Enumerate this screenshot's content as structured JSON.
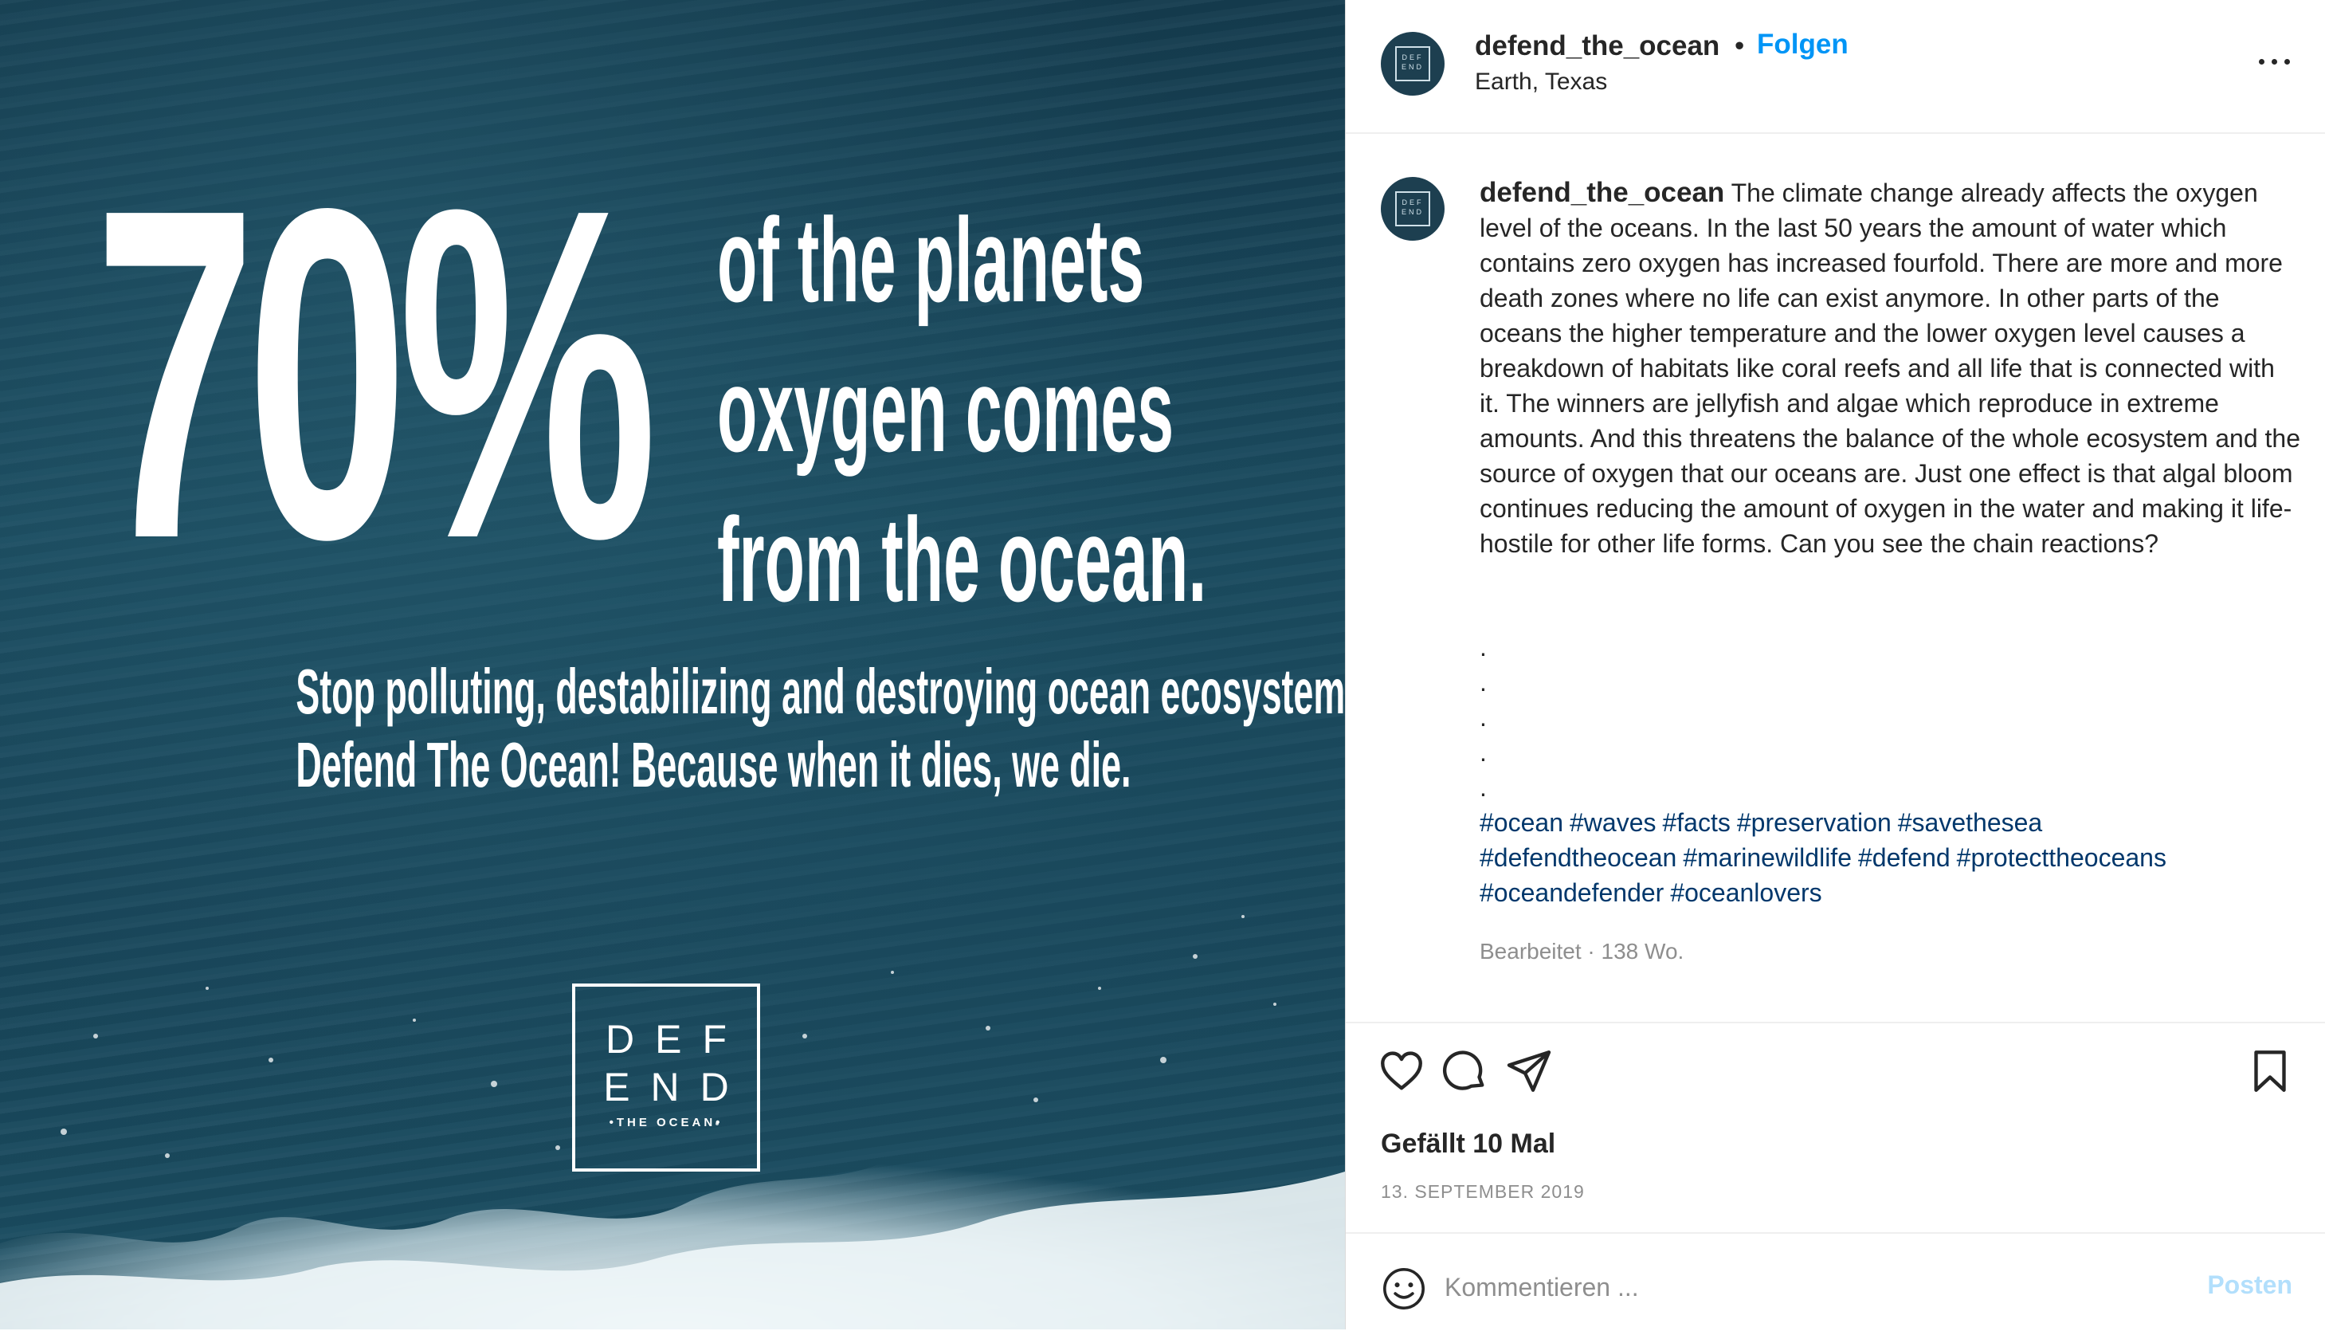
{
  "image": {
    "big_number": "70%",
    "side_lines": [
      "of the planets",
      "oxygen comes",
      "from the ocean."
    ],
    "slogan_lines": [
      "Stop polluting, destabilizing and destroying ocean ecosystems!",
      "Defend The Ocean! Because when it dies, we die."
    ],
    "logo": {
      "line1": "DEF",
      "line2": "END",
      "sub": "•THE OCEAN•"
    }
  },
  "header": {
    "username": "defend_the_ocean",
    "separator": "•",
    "follow_label": "Folgen",
    "location": "Earth, Texas"
  },
  "caption": {
    "username": "defend_the_ocean",
    "text": "The climate change already affects the oxygen level of the oceans. In the last 50 years the amount of water which contains zero oxygen has increased fourfold. There are more and more death zones where no life can exist anymore. In other parts of the oceans the higher temperature and the lower oxygen level causes a breakdown of habitats like coral reefs and all life that is connected with it. The winners are jellyfish and algae which reproduce in extreme amounts. And this threatens the balance of the whole ecosystem and the source of oxygen that our oceans are. Just one effect is that algal bloom continues reducing the amount of oxygen in the water and making it life-hostile for other life forms. Can you see the chain reactions?",
    "dots": [
      ".",
      ".",
      ".",
      ".",
      "."
    ],
    "hashtags": [
      "#ocean",
      "#waves",
      "#facts",
      "#preservation",
      "#savethesea",
      "#defendtheocean",
      "#marinewildlife",
      "#defend",
      "#protecttheoceans",
      "#oceandefender",
      "#oceanlovers"
    ],
    "edited": "Bearbeitet · 138 Wo."
  },
  "actions": {
    "icons": [
      "heart-icon",
      "comment-icon",
      "share-icon",
      "bookmark-icon"
    ],
    "likes": "Gefällt 10 Mal",
    "date": "13. SEPTEMBER 2019"
  },
  "comment": {
    "placeholder": "Kommentieren ...",
    "post_label": "Posten"
  },
  "colors": {
    "link": "#0095f6",
    "hashtag": "#00376b",
    "post_disabled": "#b2dffc",
    "ocean": "#184559"
  }
}
